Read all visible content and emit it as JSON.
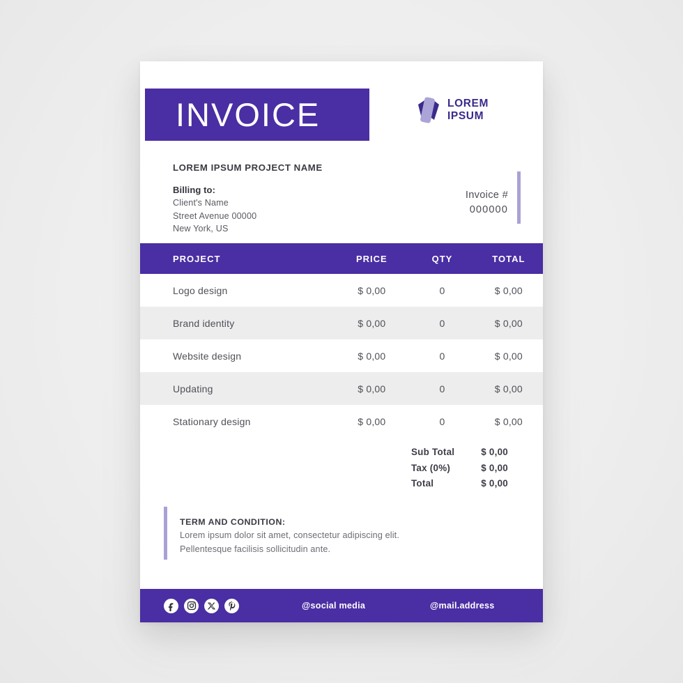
{
  "document": {
    "title": "INVOICE",
    "project_name": "LOREM IPSUM PROJECT NAME"
  },
  "brand": {
    "line1": "LOREM",
    "line2": "IPSUM",
    "mark_name": "logo-mark",
    "color_dark": "#3b2a8c",
    "color_light": "#a9a1d6"
  },
  "billing": {
    "label": "Billing to:",
    "client_name": "Client's Name",
    "street": "Street Avenue 00000",
    "city": "New York, US"
  },
  "invoice_meta": {
    "number_label": "Invoice #",
    "number_value": "000000"
  },
  "table": {
    "headers": {
      "project": "PROJECT",
      "price": "PRICE",
      "qty": "QTY",
      "total": "TOTAL"
    },
    "rows": [
      {
        "project": "Logo design",
        "price": "$ 0,00",
        "qty": "0",
        "total": "$ 0,00"
      },
      {
        "project": "Brand identity",
        "price": "$ 0,00",
        "qty": "0",
        "total": "$ 0,00"
      },
      {
        "project": "Website design",
        "price": "$ 0,00",
        "qty": "0",
        "total": "$ 0,00"
      },
      {
        "project": "Updating",
        "price": "$ 0,00",
        "qty": "0",
        "total": "$ 0,00"
      },
      {
        "project": "Stationary design",
        "price": "$ 0,00",
        "qty": "0",
        "total": "$ 0,00"
      }
    ]
  },
  "totals": {
    "subtotal_label": "Sub Total",
    "subtotal_value": "$ 0,00",
    "tax_label": "Tax (0%)",
    "tax_value": "$ 0,00",
    "total_label": "Total",
    "total_value": "$ 0,00"
  },
  "terms": {
    "title": "TERM AND CONDITION:",
    "line1": "Lorem ipsum dolor sit amet, consectetur adipiscing elit.",
    "line2": "Pellentesque facilisis sollicitudin ante."
  },
  "footer": {
    "social_icons": [
      "facebook-icon",
      "instagram-icon",
      "x-twitter-icon",
      "pinterest-icon"
    ],
    "social_handle": "@social media",
    "mail_address": "@mail.address"
  },
  "theme": {
    "purple": "#4a2ea3",
    "light_purple": "#a9a1d6",
    "row_alt": "#ededed",
    "page_bg": "#f0f0f0"
  }
}
